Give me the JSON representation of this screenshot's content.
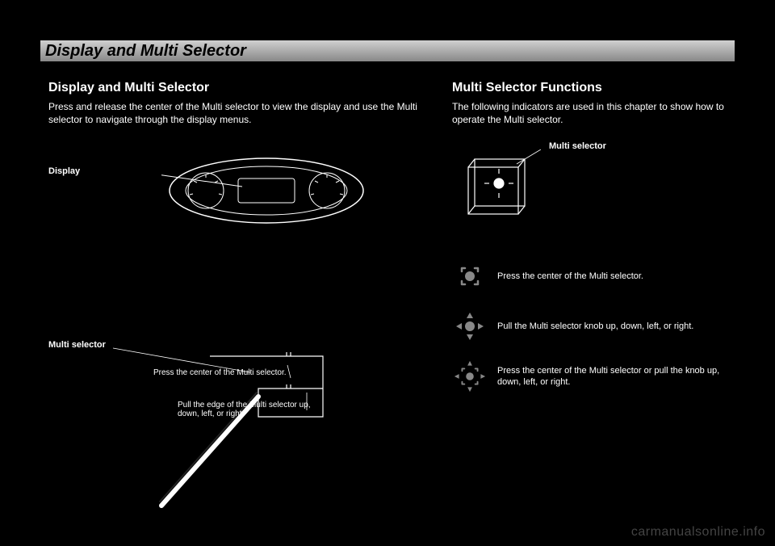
{
  "header": {
    "title": "Display and Multi Selector"
  },
  "left": {
    "section_title": "Display and Multi Selector",
    "intro": "Press and release the center of the Multi selector to view the display and use the Multi selector to navigate through the display menus.",
    "labels": {
      "display": "Display",
      "multi_selector": "Multi selector",
      "hint1": "Press the center of the Multi selector.",
      "hint2": "Pull the edge of the Multi selector up, down, left, or right."
    }
  },
  "right": {
    "section_title": "Multi Selector Functions",
    "intro": "The following indicators are used in this chapter to show how to operate the Multi selector.",
    "icons": [
      {
        "name": "press-center-icon",
        "text": "Press the center of the Multi selector."
      },
      {
        "name": "pull-direction-icon",
        "text": "Pull the Multi selector knob up, down, left, or right."
      },
      {
        "name": "press-and-pull-icon",
        "text": "Press the center of the Multi selector or pull the knob up, down, left, or right."
      }
    ]
  },
  "watermark": "carmanualsonline.info"
}
